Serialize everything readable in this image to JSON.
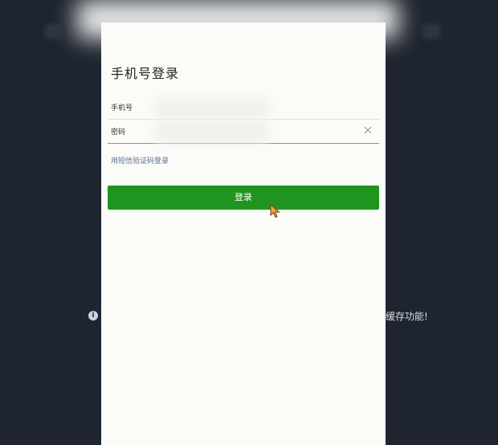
{
  "login": {
    "title": "手机号登录",
    "phone_label": "手机号",
    "password_label": "密码",
    "sms_link": "用短信验证码登录",
    "login_button": "登录"
  },
  "background": {
    "notice_text": "缓存功能!"
  },
  "colors": {
    "background": "#1f2530",
    "panel": "#fbfbf7",
    "primary_green": "#1f951f",
    "active_underline": "#5ab45a",
    "link": "#5a6f94"
  },
  "icons": {
    "clear": "close-icon",
    "info": "info-icon",
    "cursor": "mouse-cursor-icon"
  }
}
